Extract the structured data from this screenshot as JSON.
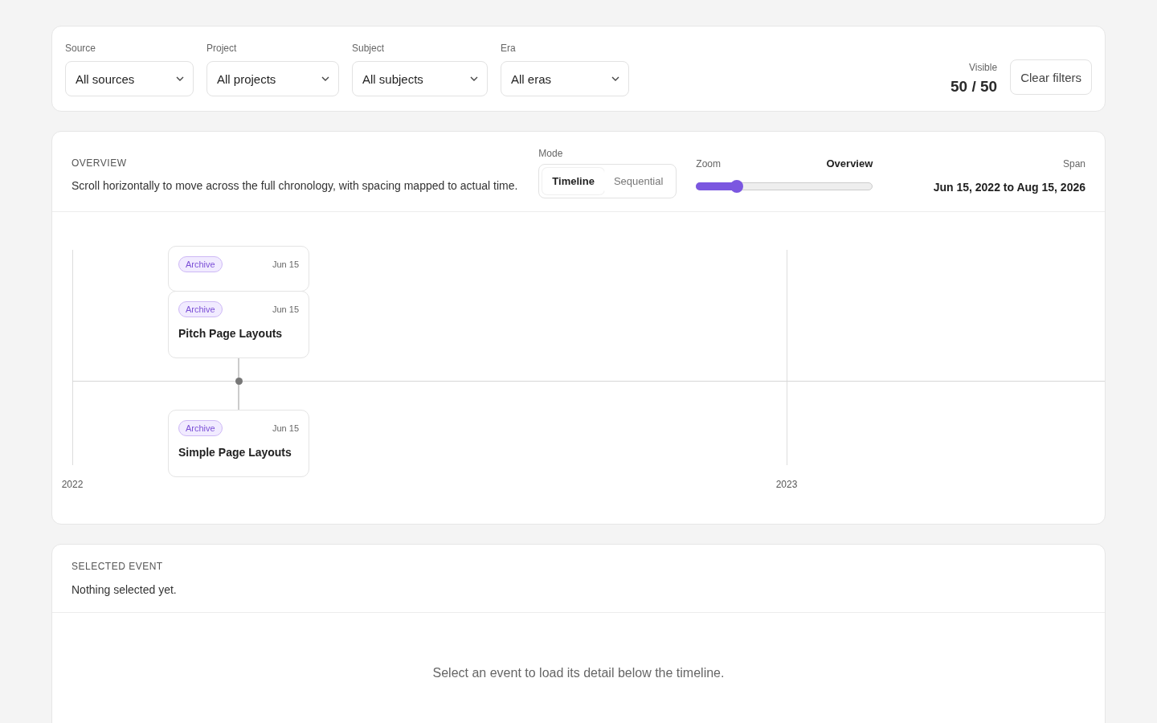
{
  "filters": [
    {
      "label": "Source",
      "value": "All sources"
    },
    {
      "label": "Project",
      "value": "All projects"
    },
    {
      "label": "Subject",
      "value": "All subjects"
    },
    {
      "label": "Era",
      "value": "All eras"
    }
  ],
  "visible": {
    "label": "Visible",
    "value": "50 / 50"
  },
  "clear_button": "Clear filters",
  "overview": {
    "heading": "OVERVIEW",
    "description": "Scroll horizontally to move across the full chronology, with spacing mapped to actual time.",
    "mode": {
      "label": "Mode",
      "options": [
        {
          "label": "Timeline",
          "selected": true
        },
        {
          "label": "Sequential",
          "selected": false
        }
      ]
    },
    "zoom": {
      "label": "Zoom",
      "value": "Overview",
      "level": 0.23
    },
    "span": {
      "label": "Span",
      "value": "Jun 15, 2022 to Aug 15, 2026"
    }
  },
  "timeline": {
    "years": [
      "2022",
      "2023"
    ],
    "events": [
      {
        "tag": "Archive",
        "date": "Jun 15"
      },
      {
        "tag": "Archive",
        "date": "Jun 15",
        "title": "Pitch Page Layouts"
      },
      {
        "tag": "Archive",
        "date": "Jun 15",
        "title": "Simple Page Layouts"
      }
    ]
  },
  "selected_event": {
    "heading": "SELECTED EVENT",
    "status": "Nothing selected yet.",
    "empty_message": "Select an event to load its detail below the timeline."
  }
}
